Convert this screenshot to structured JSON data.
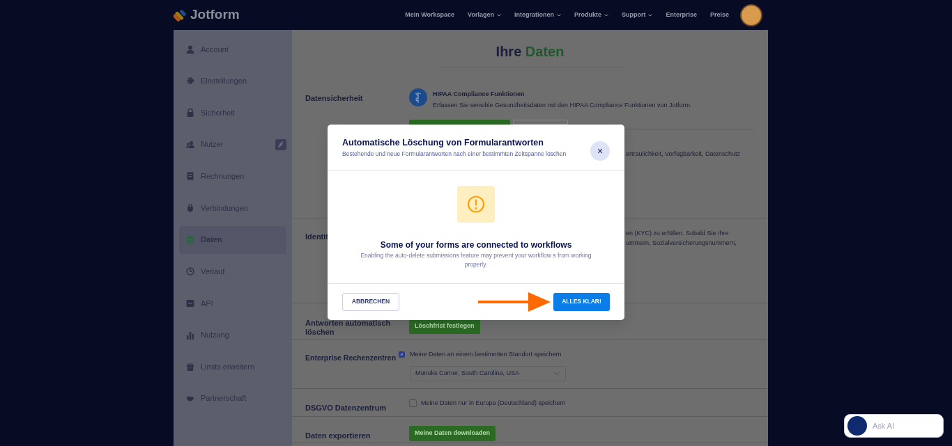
{
  "nav": {
    "logo": "Jotform",
    "items": [
      {
        "label": "Mein Workspace",
        "dropdown": false
      },
      {
        "label": "Vorlagen",
        "dropdown": true
      },
      {
        "label": "Integrationen",
        "dropdown": true
      },
      {
        "label": "Produkte",
        "dropdown": true
      },
      {
        "label": "Support",
        "dropdown": true
      },
      {
        "label": "Enterprise",
        "dropdown": false
      },
      {
        "label": "Preise",
        "dropdown": false
      }
    ]
  },
  "sidebar": {
    "items": [
      {
        "label": "Account",
        "selected": false,
        "badge": false
      },
      {
        "label": "Einstellungen",
        "selected": false,
        "badge": false
      },
      {
        "label": "Sicherheit",
        "selected": false,
        "badge": false
      },
      {
        "label": "Nutzer",
        "selected": false,
        "badge": true
      },
      {
        "label": "Rechnungen",
        "selected": false,
        "badge": false
      },
      {
        "label": "Verbindungen",
        "selected": false,
        "badge": false
      },
      {
        "label": "Daten",
        "selected": true,
        "badge": false
      },
      {
        "label": "Verlauf",
        "selected": false,
        "badge": false
      },
      {
        "label": "API",
        "selected": false,
        "badge": false
      },
      {
        "label": "Nutzung",
        "selected": false,
        "badge": false
      },
      {
        "label": "Limits erweitern",
        "selected": false,
        "badge": false
      },
      {
        "label": "Partnerschaft",
        "selected": false,
        "badge": false
      }
    ]
  },
  "page": {
    "title": "Ihre",
    "title_highlight": "Daten"
  },
  "sections": [
    {
      "kind": "features",
      "label": "Datensicherheit",
      "features": [
        {
          "title": "HIPAA Compliance Funktionen",
          "description": "Erfassen Sie sensible Gesundheitsdaten mit den HIPAA Compliance Funktionen von Jotform."
        },
        {
          "description": "ertraulichkeit, Verfügbarkeit, Datenschutz"
        }
      ]
    },
    {
      "kind": "text",
      "label": "Identit",
      "lines": [
        "en (KYC) zu erfüllen. Sobald Sie Ihre",
        "ummern, Sozialversicherungsnummern,"
      ]
    },
    {
      "kind": "button",
      "label": "Antworten automatisch löschen",
      "button": "Löschfrist festlegen"
    },
    {
      "kind": "select",
      "label": "Enterprise Rechenzentren",
      "badge": true,
      "text": "Meine Daten an einem bestimmten Standort speichern",
      "value": "Monoks Corner, South Carolina, USA"
    },
    {
      "kind": "checkbox",
      "label": "DSGVO Datenzentrum",
      "text": "Meine Daten nur in Europa (Deutschland) speichern",
      "checked": false
    },
    {
      "kind": "button",
      "label": "Daten exportieren",
      "button": "Meine Daten downloaden"
    }
  ],
  "modal": {
    "title": "Automatische Löschung von Formularantworten",
    "subtitle": "Bestehende und neue Formularantworten nach einer bestimmten Zeitspanne löschen",
    "close": "×",
    "heading": "Some of your forms are connected to workflows",
    "message": "Enabling the auto-delete submissions feature may prevent your workflow s from working properly.",
    "cancel": "ABBRECHEN",
    "confirm": "ALLES KLAR!"
  },
  "assistant": {
    "label": "Ask AI"
  }
}
